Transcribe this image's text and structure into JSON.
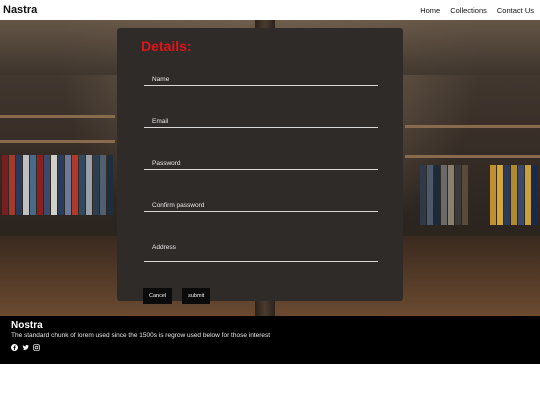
{
  "navbar": {
    "brand": "Nastra",
    "links": [
      "Home",
      "Collections",
      "Contact Us"
    ]
  },
  "form": {
    "title": "Details:",
    "fields": [
      {
        "label": "Name"
      },
      {
        "label": "Email"
      },
      {
        "label": "Password"
      },
      {
        "label": "Confirm password"
      },
      {
        "label": "Address"
      }
    ],
    "cancel_label": "Cancel",
    "submit_label": "submit"
  },
  "footer": {
    "title": "Nostra",
    "text": "The standard chunk of lorem used since the 1500s is regrow used below for those interest",
    "social_icons": [
      "facebook-icon",
      "twitter-icon",
      "instagram-icon"
    ]
  },
  "colors": {
    "title_red": "#e0141b",
    "panel_bg": "#2f2b29",
    "footer_bg": "#000000"
  }
}
